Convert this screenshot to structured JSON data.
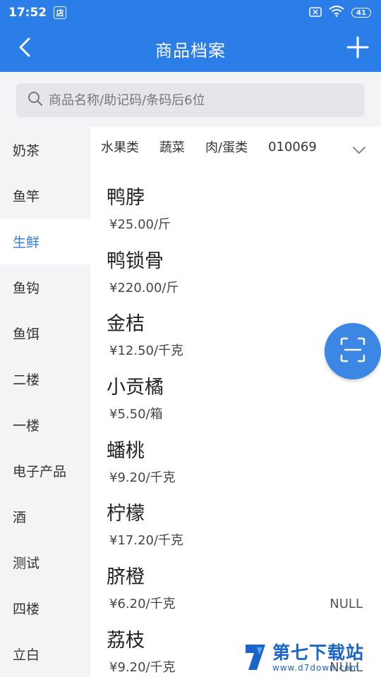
{
  "status_bar": {
    "time": "17:52",
    "app_badge": "店",
    "battery": "41",
    "icons": [
      "store-badge-icon",
      "sim-x-icon",
      "wifi-icon",
      "battery-icon"
    ]
  },
  "header": {
    "title": "商品档案",
    "back_icon": "chevron-left-icon",
    "add_icon": "plus-icon",
    "color": "#2b7ee8"
  },
  "search": {
    "placeholder": "商品名称/助记码/条码后6位",
    "value": ""
  },
  "sidebar": {
    "items": [
      {
        "label": "奶茶",
        "active": false
      },
      {
        "label": "鱼竿",
        "active": false
      },
      {
        "label": "生鲜",
        "active": true
      },
      {
        "label": "鱼钩",
        "active": false
      },
      {
        "label": "鱼饵",
        "active": false
      },
      {
        "label": "二楼",
        "active": false
      },
      {
        "label": "一楼",
        "active": false
      },
      {
        "label": "电子产品",
        "active": false
      },
      {
        "label": "酒",
        "active": false
      },
      {
        "label": "测试",
        "active": false
      },
      {
        "label": "四楼",
        "active": false
      },
      {
        "label": "立白",
        "active": false
      }
    ]
  },
  "category_tabs": {
    "items": [
      "水果类",
      "蔬菜",
      "肉/蛋类",
      "010069"
    ],
    "more_icon": "chevron-down-icon"
  },
  "products": [
    {
      "name": "鸭脖",
      "price": "¥25.00/斤",
      "extra": ""
    },
    {
      "name": "鸭锁骨",
      "price": "¥220.00/斤",
      "extra": ""
    },
    {
      "name": "金桔",
      "price": "¥12.50/千克",
      "extra": ""
    },
    {
      "name": "小贡橘",
      "price": "¥5.50/箱",
      "extra": ""
    },
    {
      "name": "蟠桃",
      "price": "¥9.20/千克",
      "extra": ""
    },
    {
      "name": "柠檬",
      "price": "¥17.20/千克",
      "extra": ""
    },
    {
      "name": "脐橙",
      "price": "¥6.20/千克",
      "extra": "NULL"
    },
    {
      "name": "荔枝",
      "price": "¥9.20/千克",
      "extra": "NULL"
    }
  ],
  "fab": {
    "icon": "scan-icon"
  },
  "watermark": {
    "title": "第七下载站",
    "url": "www.d7down.com"
  }
}
